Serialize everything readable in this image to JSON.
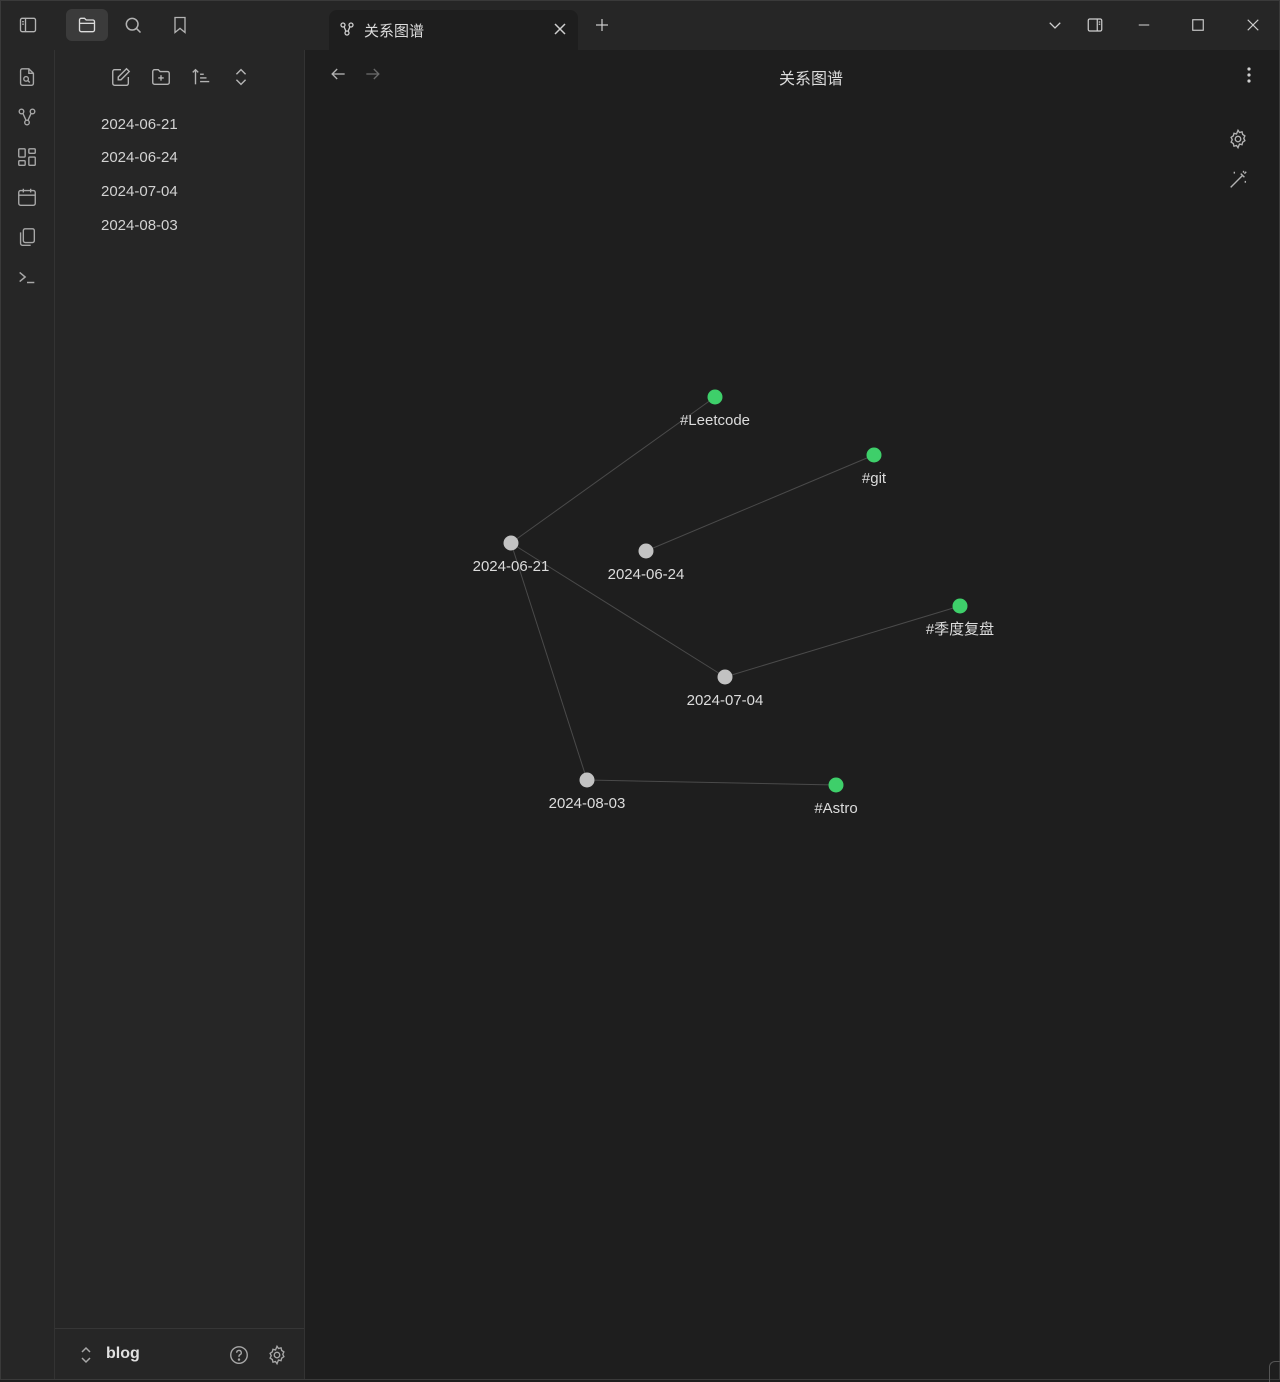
{
  "tab": {
    "title": "关系图谱",
    "icon": "graph-icon"
  },
  "view": {
    "title": "关系图谱"
  },
  "files": [
    {
      "name": "2024-06-21"
    },
    {
      "name": "2024-06-24"
    },
    {
      "name": "2024-07-04"
    },
    {
      "name": "2024-08-03"
    }
  ],
  "vault": {
    "name": "blog"
  },
  "colors": {
    "note_node": "#c2c2c2",
    "tag_node": "#3ecf6a",
    "edge": "#4a4a4a",
    "background": "#1e1e1e"
  },
  "graph": {
    "nodes": [
      {
        "id": "n0621",
        "label": "2024-06-21",
        "kind": "note"
      },
      {
        "id": "n0624",
        "label": "2024-06-24",
        "kind": "note"
      },
      {
        "id": "n0704",
        "label": "2024-07-04",
        "kind": "note"
      },
      {
        "id": "n0803",
        "label": "2024-08-03",
        "kind": "note"
      },
      {
        "id": "tLeet",
        "label": "#Leetcode",
        "kind": "tag"
      },
      {
        "id": "tGit",
        "label": "#git",
        "kind": "tag"
      },
      {
        "id": "tReview",
        "label": "#季度复盘",
        "kind": "tag"
      },
      {
        "id": "tAstro",
        "label": "#Astro",
        "kind": "tag"
      }
    ],
    "edges": [
      [
        "n0621",
        "tLeet"
      ],
      [
        "n0621",
        "n0704"
      ],
      [
        "n0621",
        "n0803"
      ],
      [
        "n0624",
        "tGit"
      ],
      [
        "n0704",
        "tReview"
      ],
      [
        "n0803",
        "tAstro"
      ]
    ]
  }
}
